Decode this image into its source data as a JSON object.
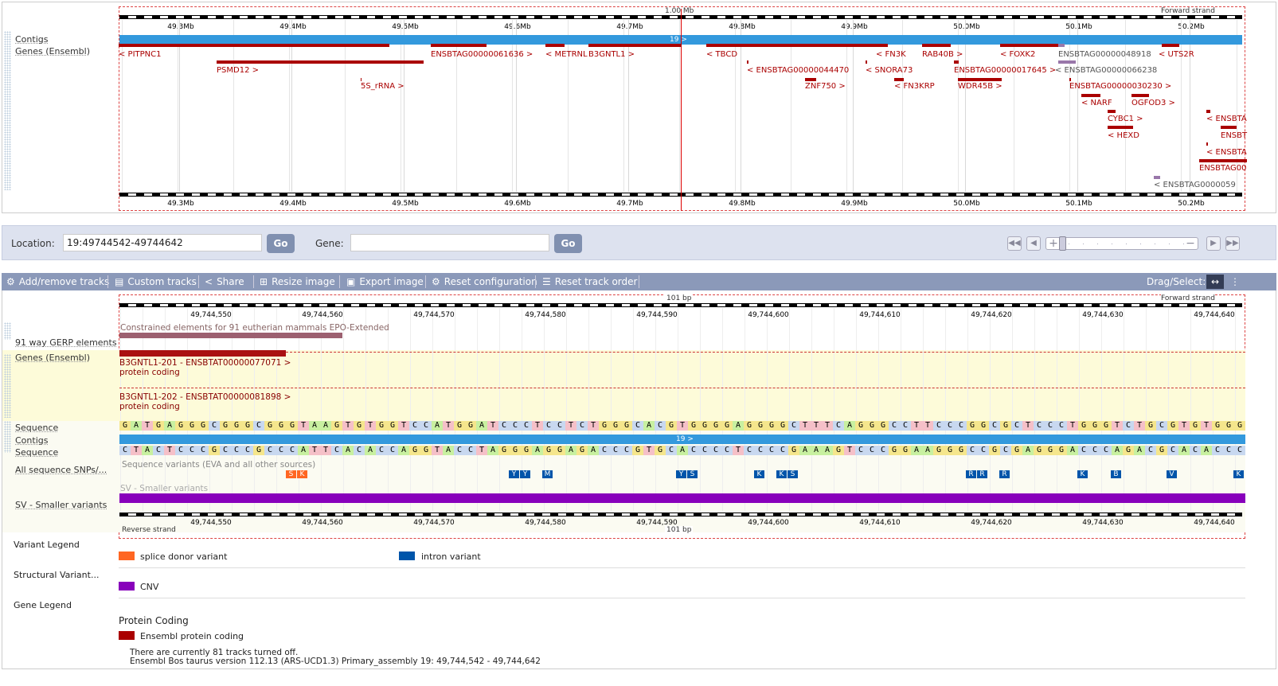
{
  "overview": {
    "scale_label": "1.00 Mb",
    "strand_top": "Forward strand",
    "ticks": [
      "49.3Mb",
      "49.4Mb",
      "49.5Mb",
      "49.6Mb",
      "49.7Mb",
      "49.8Mb",
      "49.9Mb",
      "50.0Mb",
      "50.1Mb",
      "50.2Mb"
    ],
    "tracks": {
      "contigs": "Contigs",
      "genes": "Genes (Ensembl)"
    },
    "contig_label": "19 >",
    "genes": [
      {
        "label": "< PITPNC1"
      },
      {
        "label": "PSMD12 >"
      },
      {
        "label": "5S_rRNA >"
      },
      {
        "label": "ENSBTAG00000061636 >"
      },
      {
        "label": "< METRNL"
      },
      {
        "label": "B3GNTL1 >"
      },
      {
        "label": "< TBCD"
      },
      {
        "label": "< ENSBTAG00000044470"
      },
      {
        "label": "ZNF750 >"
      },
      {
        "label": "< FN3K"
      },
      {
        "label": "< SNORA73"
      },
      {
        "label": "< FN3KRP"
      },
      {
        "label": "RAB40B >"
      },
      {
        "label": "ENSBTAG00000017645 >"
      },
      {
        "label": "WDR45B >"
      },
      {
        "label": "< FOXK2"
      },
      {
        "label": "ENSBTAG00000048918"
      },
      {
        "label": "< ENSBTAG00000066238"
      },
      {
        "label": "ENSBTAG00000030230 >"
      },
      {
        "label": "< UTS2R"
      },
      {
        "label": "< NARF"
      },
      {
        "label": "OGFOD3 >"
      },
      {
        "label": "CYBC1 >"
      },
      {
        "label": "< HEXD"
      },
      {
        "label": "< ENSBTA"
      },
      {
        "label": "ENSBT"
      },
      {
        "label": "< ENSBTA"
      },
      {
        "label": "ENSBTAG00"
      },
      {
        "label": "< ENSBTAG0000059"
      }
    ]
  },
  "nav": {
    "location_label": "Location:",
    "location_value": "19:49744542-49744642",
    "go": "Go",
    "gene_label": "Gene:",
    "gene_value": ""
  },
  "toolbar": {
    "add_remove": "Add/remove tracks",
    "custom": "Custom tracks",
    "share": "Share",
    "resize": "Resize image",
    "export": "Export image",
    "reset_config": "Reset configuration",
    "reset_order": "Reset track order",
    "drag_select": "Drag/Select:"
  },
  "detail": {
    "scale_label": "101 bp",
    "strand_top": "Forward strand",
    "strand_bottom": "Reverse strand",
    "ticks": [
      "49,744,550",
      "49,744,560",
      "49,744,570",
      "49,744,580",
      "49,744,590",
      "49,744,600",
      "49,744,610",
      "49,744,620",
      "49,744,630",
      "49,744,640"
    ],
    "tracks": {
      "gerp": "91 way GERP elements",
      "genes": "Genes (Ensembl)",
      "sequence": "Sequence",
      "contigs": "Contigs",
      "sequence2": "Sequence",
      "snps": "All sequence SNPs/...",
      "sv": "SV - Smaller variants"
    },
    "gerp_text": "Constrained elements for 91 eutherian mammals EPO-Extended",
    "transcript1": "B3GNTL1-201 - ENSBTAT00000077071 >",
    "transcript1_type": "protein coding",
    "transcript2": "B3GNTL1-202 - ENSBTAT00000081898 >",
    "transcript2_type": "protein coding",
    "seq_forward": "GATGAGGGCGGGCGGGTAAGTGTGGTCCATGGATCCCTCCTCTGGGCACGTGGGGAGGGGCTTTCAGGGCCTTCCCGGCGCTCCCTGGGTCTGCGTGTGGG",
    "seq_reverse": "CTACTCCCGCCCGCCCATTCACACCAGGTACCTAGGGAGGAGACCCGTGCACCCCTCCCCGAAAGTCCCGGAAGGGCCGCGAGGGACCCAGACGCACACCC",
    "contig_label": "19 >",
    "snp_text": "Sequence variants (EVA and all other sources)",
    "sv_text": "SV - Smaller variants",
    "snps": [
      "S",
      "K",
      "Y",
      "Y",
      "M",
      "Y",
      "S",
      "K",
      "K",
      "S",
      "R",
      "R",
      "R",
      "K",
      "B",
      "V",
      "K"
    ]
  },
  "legend": {
    "variant_title": "Variant Legend",
    "splice": "splice donor variant",
    "intron": "intron variant",
    "structural_title": "Structural Variant...",
    "cnv": "CNV",
    "gene_title": "Gene Legend",
    "protein_coding": "Protein Coding",
    "ensembl_protein": "Ensembl protein coding"
  },
  "footer": {
    "line1": "There are currently 81 tracks turned off.",
    "line2": "Ensembl Bos taurus version 112.13 (ARS-UCD1.3) Primary_assembly 19: 49,744,542 - 49,744,642"
  },
  "colors": {
    "gene": "#aa0000",
    "contig": "#3399dd",
    "splice": "#ff6622",
    "intron": "#0055aa",
    "cnv": "#8800bb",
    "toolbar": "#8b99b9"
  }
}
